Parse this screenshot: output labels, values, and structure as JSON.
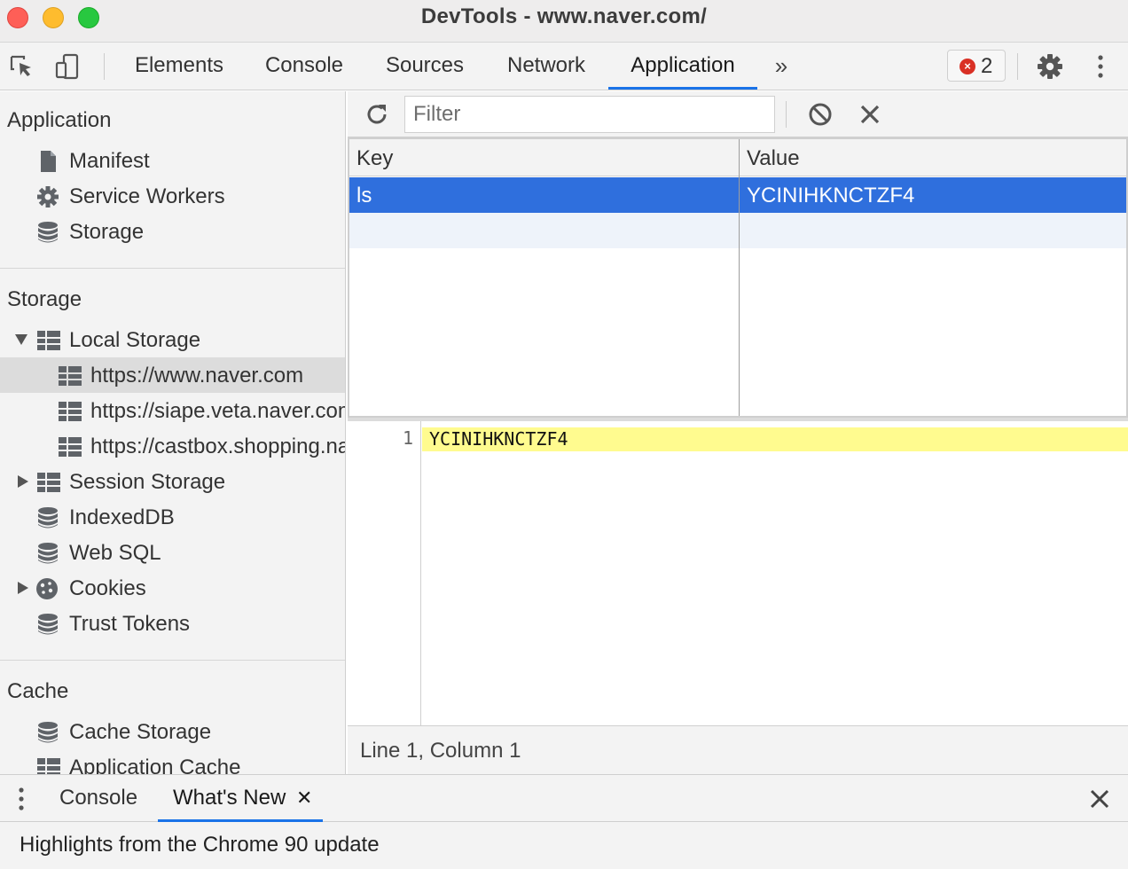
{
  "window": {
    "title": "DevTools - www.naver.com/"
  },
  "toolbar": {
    "tabs": [
      "Elements",
      "Console",
      "Sources",
      "Network",
      "Application"
    ],
    "active_tab": "Application",
    "more_tabs": "»",
    "error_count": "2",
    "accent_color": "#1a73e8"
  },
  "sidebar": {
    "application": {
      "title": "Application",
      "items": [
        "Manifest",
        "Service Workers",
        "Storage"
      ]
    },
    "storage": {
      "title": "Storage",
      "local_storage": "Local Storage",
      "origins": [
        "https://www.naver.com",
        "https://siape.veta.naver.com",
        "https://castbox.shopping.naver.com"
      ],
      "items": [
        "Session Storage",
        "IndexedDB",
        "Web SQL",
        "Cookies",
        "Trust Tokens"
      ]
    },
    "cache": {
      "title": "Cache",
      "items": [
        "Cache Storage",
        "Application Cache"
      ]
    }
  },
  "storage_view": {
    "filter_placeholder": "Filter",
    "columns": {
      "key": "Key",
      "value": "Value"
    },
    "rows": [
      {
        "key": "ls",
        "value": "YCINIHKNCTZF4"
      }
    ],
    "selected_row_color": "#2f6fdd"
  },
  "preview": {
    "line_number": "1",
    "code": "YCINIHKNCTZF4",
    "status": "Line 1, Column 1"
  },
  "drawer": {
    "tabs": [
      "Console",
      "What's New"
    ],
    "active_tab": "What's New",
    "close_tab_glyph": "✕",
    "content": "Highlights from the Chrome 90 update"
  }
}
